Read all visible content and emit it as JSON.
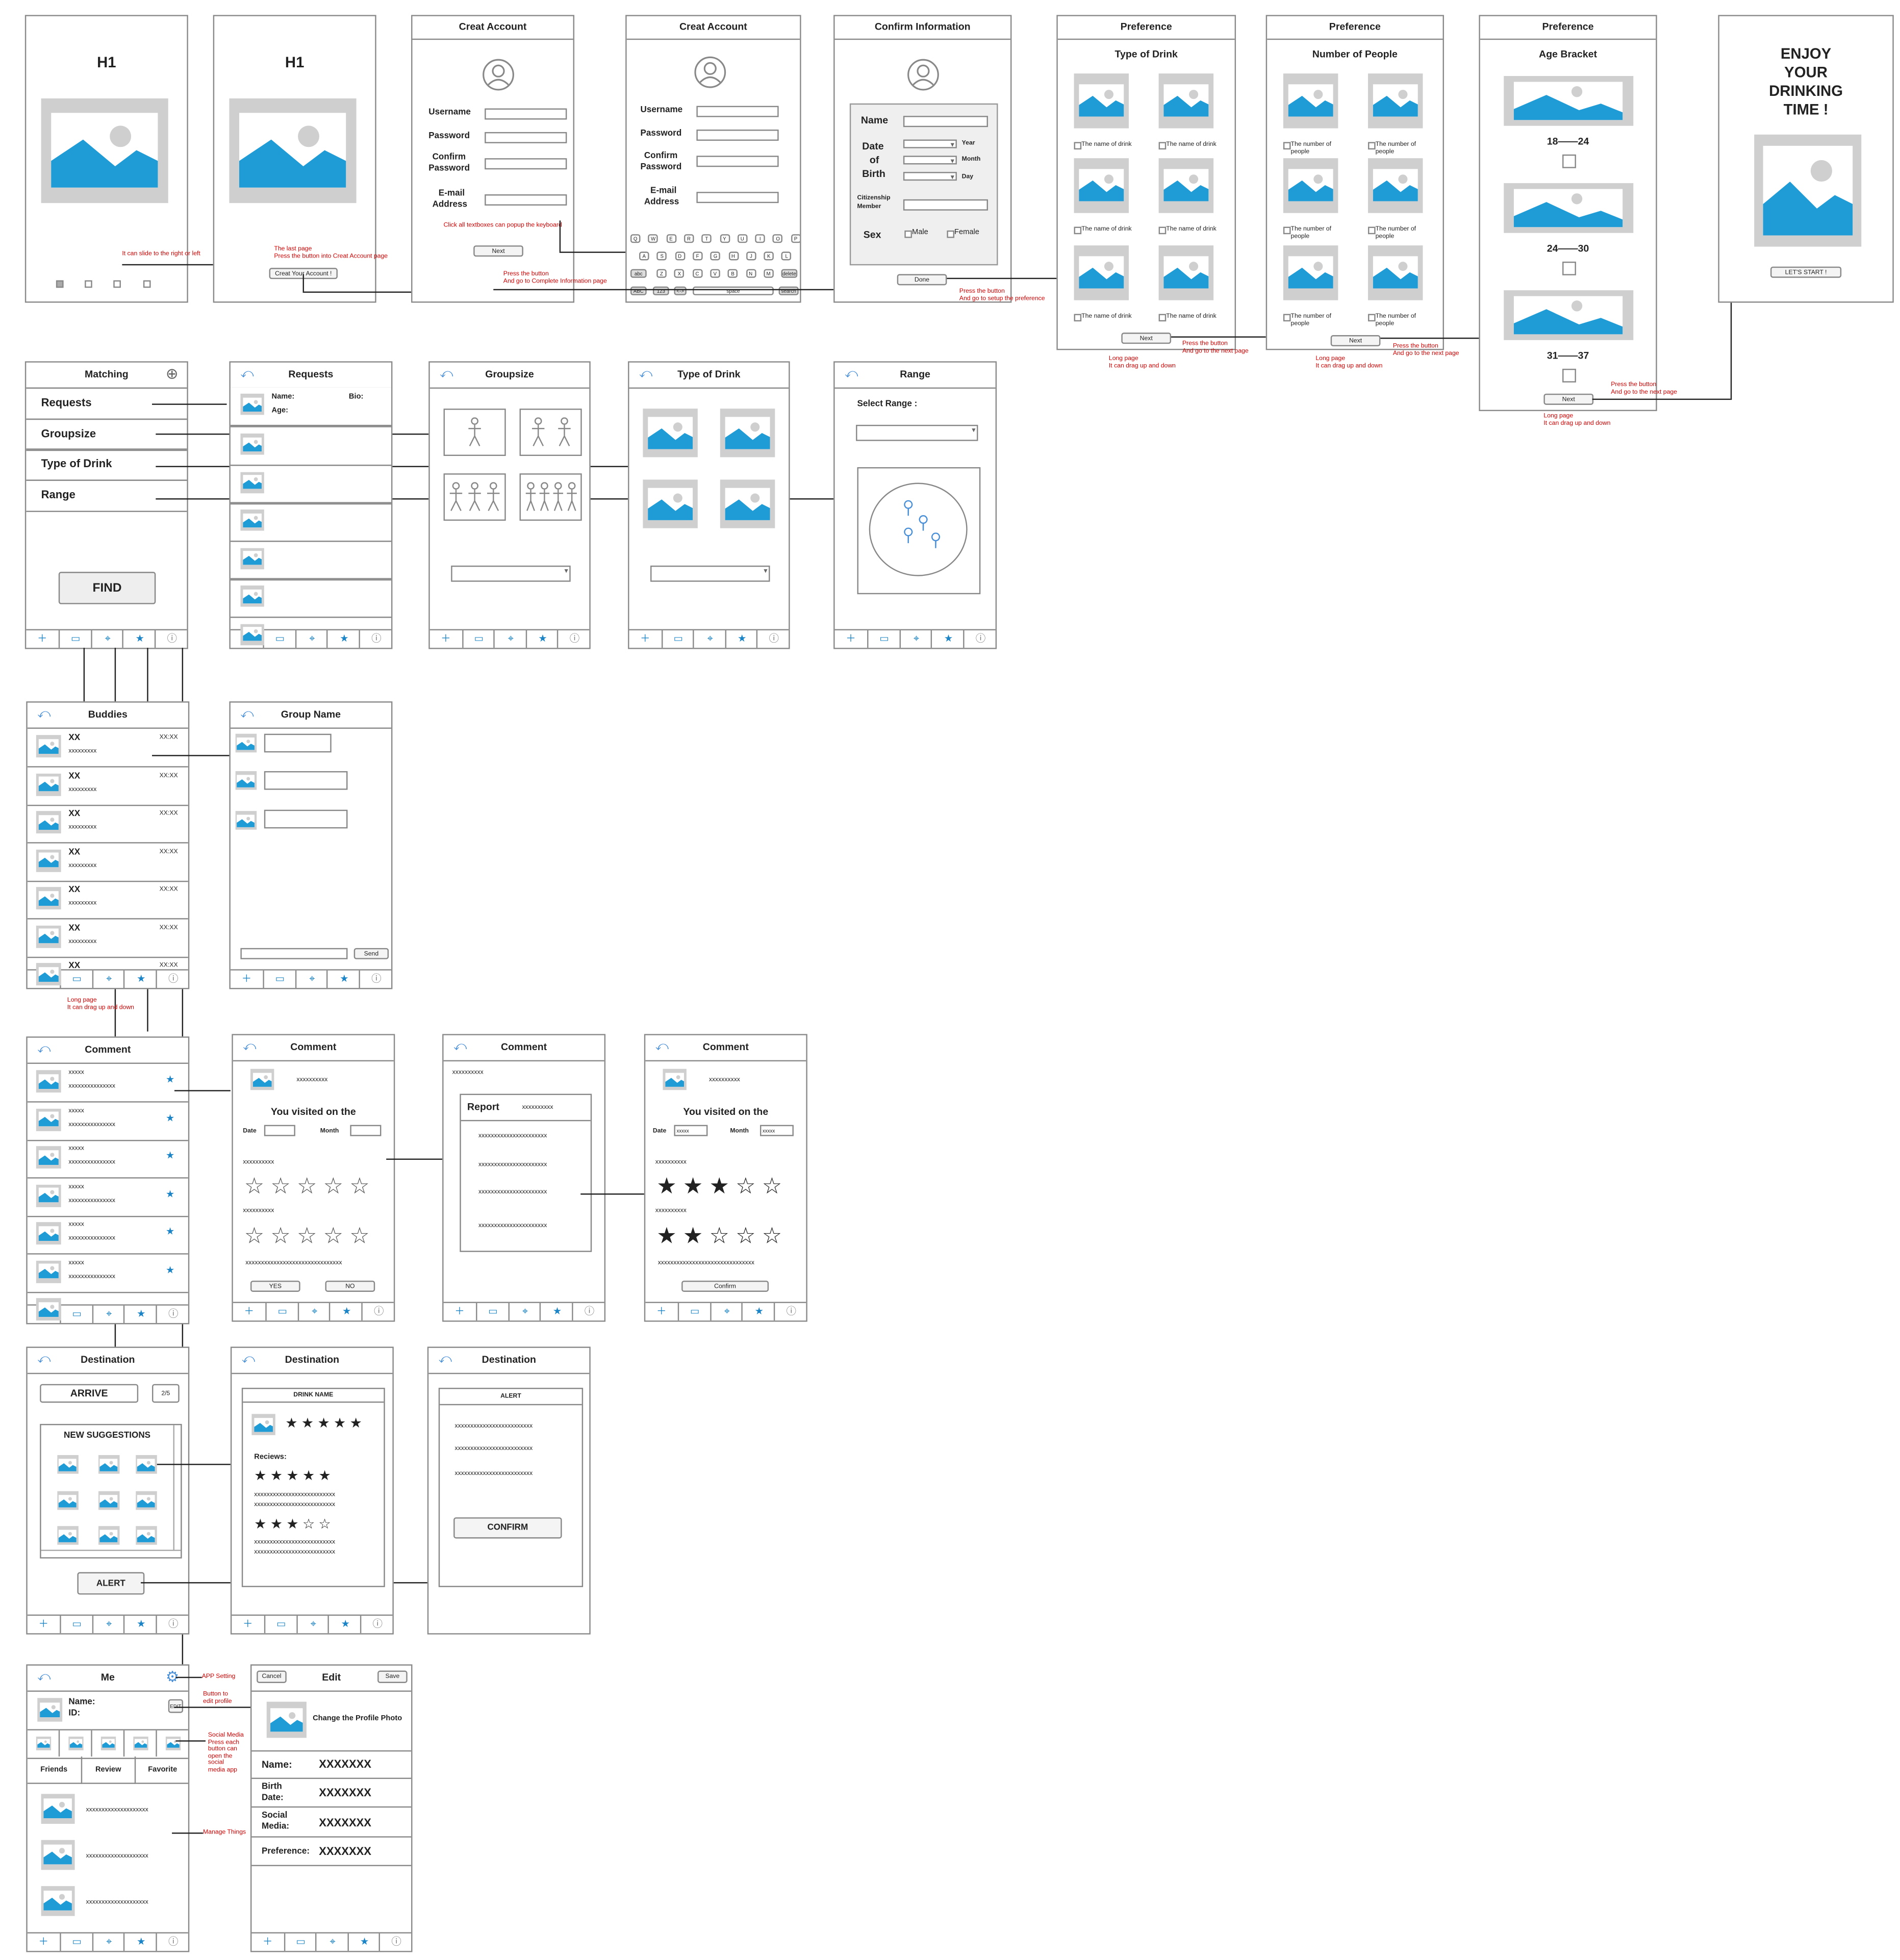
{
  "onboarding": {
    "h1": "H1",
    "slide_note": "It can slide to the right or left",
    "last_page_note_1": "The last page",
    "last_page_note_2": "Press the button into Creat Account page",
    "create_btn": "Creat Your Account !"
  },
  "create1": {
    "title": "Creat   Account",
    "username": "Username",
    "password": "Password",
    "confirm1": "Confirm",
    "confirm2": "Password",
    "email1": "E-mail",
    "email2": "Address",
    "kb_note": "Click all textboxes can popup the keyboard",
    "next": "Next"
  },
  "create2": {
    "title": "Creat Account",
    "username": "Username",
    "password": "Password",
    "confirm1": "Confirm",
    "confirm2": "Password",
    "email1": "E-mail",
    "email2": "Address",
    "note1": "Press the button",
    "note2": "And go to Complete Information page",
    "keys_r1": [
      "Q",
      "W",
      "E",
      "R",
      "T",
      "Y",
      "U",
      "I",
      "O",
      "P"
    ],
    "keys_r2": [
      "A",
      "S",
      "D",
      "F",
      "G",
      "H",
      "J",
      "K",
      "L"
    ],
    "keys_r3": [
      "Z",
      "X",
      "C",
      "V",
      "B",
      "N",
      "M"
    ],
    "abc": "abc",
    "delete": "delete",
    "ABC": "ABC",
    "n123": "123",
    "arrows": "<->",
    "space": "space",
    "search": "search"
  },
  "confirm_info": {
    "title": "Confirm Information",
    "name": "Name",
    "dob1": "Date",
    "dob2": "of",
    "dob3": "Birth",
    "year": "Year",
    "month": "Month",
    "day": "Day",
    "citizen1": "Citizenship",
    "citizen2": "Member",
    "sex": "Sex",
    "male": "Male",
    "female": "Female",
    "done": "Done",
    "note1": "Press the button",
    "note2": "And go to setup the preference"
  },
  "pref_drink": {
    "title": "Preference",
    "subtitle": "Type of Drink",
    "item": "The name of drink",
    "next": "Next",
    "long1": "Long page",
    "long2": "It can drag up and down",
    "note1": "Press the button",
    "note2": "And go to the next page"
  },
  "pref_people": {
    "title": "Preference",
    "subtitle": "Number of People",
    "item1": "The number of",
    "item2": "people",
    "next": "Next",
    "long1": "Long page",
    "long2": "It can drag up and down",
    "note1": "Press the button",
    "note2": "And go to the next page"
  },
  "pref_age": {
    "title": "Preference",
    "subtitle": "Age Bracket",
    "r1": "18——24",
    "r2": "24——30",
    "r3": "31——37",
    "next": "Next",
    "long1": "Long page",
    "long2": "It can drag up and down",
    "note1": "Press the button",
    "note2": "And go to the next page"
  },
  "enjoy": {
    "l1": "ENJOY",
    "l2": "YOUR",
    "l3": "DRINKING",
    "l4": "TIME !",
    "start": "LET'S START !"
  },
  "matching": {
    "title": "Matching",
    "items": [
      "Requests",
      "Groupsize",
      "Type of Drink",
      "Range"
    ],
    "find": "FIND"
  },
  "requests": {
    "title": "Requests",
    "name": "Name:",
    "bio": "Bio:",
    "age": "Age:"
  },
  "groupsize": {
    "title": "Groupsize"
  },
  "type_drink": {
    "title": "Type of Drink"
  },
  "range": {
    "title": "Range",
    "select": "Select Range :"
  },
  "buddies": {
    "title": "Buddies",
    "name": "XX",
    "sub": "xxxxxxxxx",
    "time": "XX:XX",
    "long1": "Long page",
    "long2": "It can drag up and down"
  },
  "group_name": {
    "title": "Group Name",
    "send": "Send"
  },
  "comment_list": {
    "title": "Comment",
    "name": "xxxxx",
    "sub": "xxxxxxxxxxxxxxx"
  },
  "comment1": {
    "title": "Comment",
    "user": "xxxxxxxxxx",
    "visited": "You visited on the",
    "date": "Date",
    "month": "Month",
    "q1": "xxxxxxxxxx",
    "q2": "xxxxxxxxxx",
    "q3": "xxxxxxxxxxxxxxxxxxxxxxxxxxxxxxx",
    "yes": "YES",
    "no": "NO"
  },
  "comment2": {
    "title": "Comment",
    "user": "xxxxxxxxxx",
    "report": "Report",
    "report_user": "xxxxxxxxxx",
    "line": "xxxxxxxxxxxxxxxxxxxxxx"
  },
  "comment3": {
    "title": "Comment",
    "user": "xxxxxxxxxx",
    "visited": "You visited on the",
    "date": "Date",
    "month": "Month",
    "date_val": "xxxxx",
    "month_val": "xxxxx",
    "q1": "xxxxxxxxxx",
    "q2": "xxxxxxxxxx",
    "q3": "xxxxxxxxxxxxxxxxxxxxxxxxxxxxxxx",
    "confirm": "Confirm"
  },
  "dest1": {
    "title": "Destination",
    "arrive": "ARRIVE",
    "count": "2/5",
    "suggest": "NEW SUGGESTIONS",
    "alert": "ALERT"
  },
  "dest2": {
    "title": "Destination",
    "drink": "DRINK NAME",
    "reviews": "Reciews:",
    "line": "xxxxxxxxxxxxxxxxxxxxxxxxxx"
  },
  "dest3": {
    "title": "Destination",
    "alert": "ALERT",
    "line": "xxxxxxxxxxxxxxxxxxxxxxxxx",
    "confirm": "CONFIRM"
  },
  "me": {
    "title": "Me",
    "name": "Name:",
    "id": "ID:",
    "edit": "EDIT",
    "tabs": [
      "Friends",
      "Review",
      "Favorite"
    ],
    "item": "xxxxxxxxxxxxxxxxxxxx",
    "n_setting": "APP Setting",
    "n_edit1": "Button to",
    "n_edit2": "edit profile",
    "n_social": [
      "Social Media",
      "Press each",
      "button can",
      "open the",
      "social",
      "media app"
    ],
    "n_manage": "Manage Things"
  },
  "edit": {
    "title": "Edit",
    "cancel": "Cancel",
    "save": "Save",
    "change": "Change the Profile Photo",
    "name": "Name:",
    "birth1": "Birth",
    "birth2": "Date:",
    "social1": "Social",
    "social2": "Media:",
    "pref": "Preference:",
    "value": "XXXXXXX"
  },
  "colors": {
    "accent": "#1b84c6",
    "note": "#d40000",
    "placeholder": "#cfcfcf"
  }
}
